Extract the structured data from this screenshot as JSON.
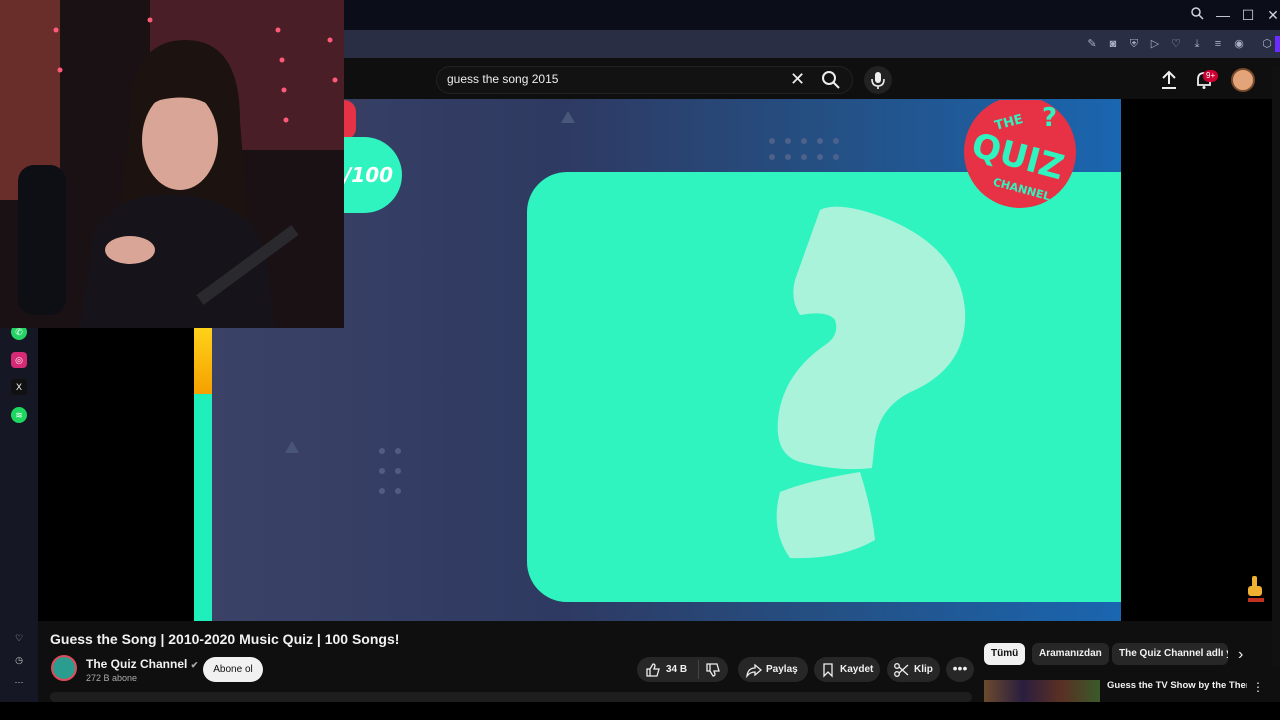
{
  "search": {
    "query": "guess the song 2015"
  },
  "header": {
    "notification_badge": "9+"
  },
  "video": {
    "counter": "/100",
    "logo_text_top": "THE",
    "logo_text_main": "QUIZ",
    "logo_text_bottom": "CHANNEL"
  },
  "watch": {
    "title": "Guess the Song | 2010-2020 Music Quiz | 100 Songs!",
    "channel_name": "The Quiz Channel",
    "subscribers": "272 B abone",
    "subscribe_label": "Abone ol",
    "like_count": "34 B",
    "share_label": "Paylaş",
    "save_label": "Kaydet",
    "clip_label": "Klip",
    "more_label": "•••"
  },
  "chips": [
    "Tümü",
    "Aramanızdan",
    "The Quiz Channel adlı yü"
  ],
  "recommendation": {
    "title": "Guess the TV Show by the Theme Song | Guess the Them"
  },
  "colors": {
    "accent": "#2ff4c0",
    "notification": "#cc0033",
    "video_bg": "#2e3a62"
  }
}
